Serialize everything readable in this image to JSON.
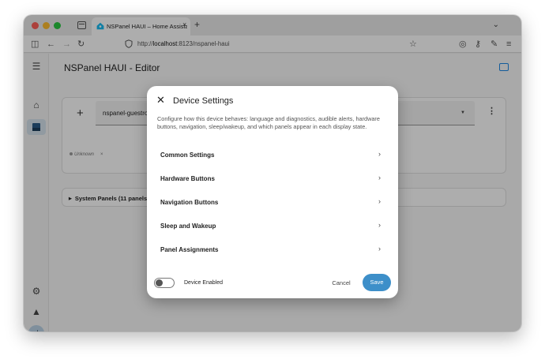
{
  "browser": {
    "tab_title": "NSPanel HAUI – Home Assistant",
    "tab_close": "×",
    "new_tab": "+",
    "url_prefix": "http://",
    "url_host": "localhost",
    "url_rest": ":8123/nspanel-haui"
  },
  "app": {
    "title": "NSPanel HAUI - Editor",
    "avatar_letter": "d"
  },
  "device_card": {
    "add": "+",
    "selected_device": "nspanel-guestroo",
    "status": "Unknown",
    "status_close": "×"
  },
  "system_panels": {
    "label": "System Panels (11 panels)"
  },
  "dialog": {
    "title": "Device Settings",
    "description": "Configure how this device behaves: language and diagnostics, audible alerts, hardware buttons, navigation, sleep/wakeup, and which panels appear in each display state.",
    "items": [
      {
        "label": "Common Settings"
      },
      {
        "label": "Hardware Buttons"
      },
      {
        "label": "Navigation Buttons"
      },
      {
        "label": "Sleep and Wakeup"
      },
      {
        "label": "Panel Assignments"
      }
    ],
    "toggle_label": "Device Enabled",
    "toggle_on": false,
    "cancel_label": "Cancel",
    "save_label": "Save"
  },
  "colors": {
    "accent": "#3d8fc9",
    "sidebar_active": "#d6e3ee"
  }
}
